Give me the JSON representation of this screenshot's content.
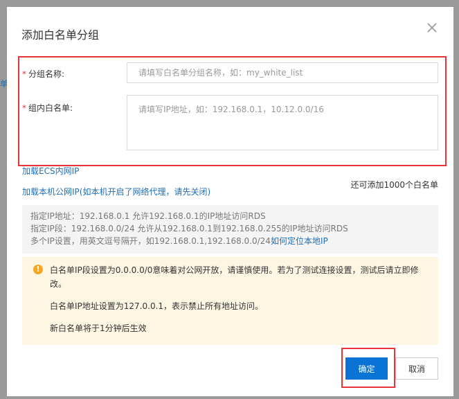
{
  "background": {
    "fragment": "单"
  },
  "dialog": {
    "title": "添加白名单分组",
    "close_icon": "close-icon"
  },
  "form": {
    "group_name": {
      "required_mark": "*",
      "label": "分组名称:",
      "placeholder": "请填写白名单分组名称，如：my_white_list",
      "value": ""
    },
    "whitelist": {
      "required_mark": "*",
      "label": "组内白名单:",
      "placeholder": "请填写IP地址，如：192.168.0.1，10.12.0.0/16",
      "value": ""
    }
  },
  "links": {
    "load_ecs": "加载ECS内网IP",
    "load_local": "加载本机公网IP(如本机开启了网络代理，请先关闭)"
  },
  "remaining": "还可添加1000个白名单",
  "help": {
    "line1": "指定IP地址：192.168.0.1 允许192.168.0.1的IP地址访问RDS",
    "line2": "指定IP段：192.168.0.0/24 允许从192.168.0.1到192.168.0.255的IP地址访问RDS",
    "line3_prefix": "多个IP设置，用英文逗号隔开，如192.168.0.1,192.168.0.0/24",
    "line3_link": "如何定位本地IP"
  },
  "warning": {
    "icon": "exclamation-circle-icon",
    "icon_glyph": "!",
    "text1": "白名单IP段设置为0.0.0.0/0意味着对公网开放，请谨慎使用。若为了测试连接设置，测试后请立即修改。",
    "text2": "白名单IP地址设置为127.0.0.1，表示禁止所有地址访问。",
    "text3": "新白名单将于1分钟后生效"
  },
  "buttons": {
    "ok": "确定",
    "cancel": "取消"
  },
  "colors": {
    "primary": "#0a73d6",
    "link": "#1f6fb6",
    "highlight_border": "#e8333a",
    "warning_bg": "#fdf6e3",
    "warning_icon": "#f5a623"
  }
}
